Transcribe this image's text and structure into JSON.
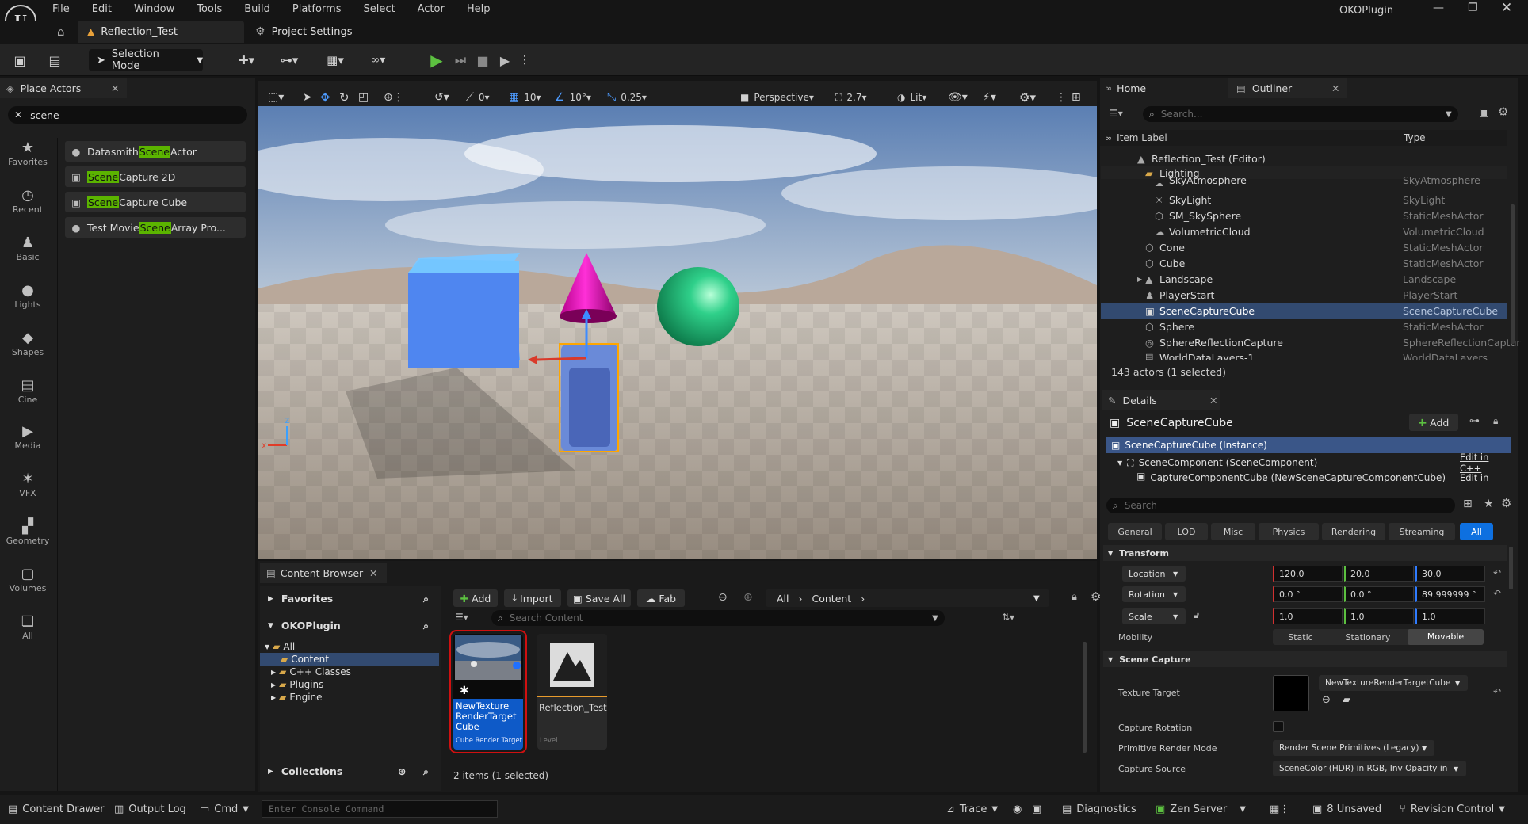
{
  "menu": [
    "File",
    "Edit",
    "Window",
    "Tools",
    "Build",
    "Platforms",
    "Select",
    "Actor",
    "Help"
  ],
  "project_name": "OKOPlugin",
  "tabs": {
    "level": "Reflection_Test",
    "project_settings": "Project Settings"
  },
  "toolbar": {
    "selection_mode": "Selection Mode"
  },
  "place_actors": {
    "tab_label": "Place Actors",
    "search_value": "scene",
    "categories": [
      "Favorites",
      "Recent",
      "Basic",
      "Lights",
      "Shapes",
      "Cine",
      "Media",
      "VFX",
      "Geometry",
      "Volumes",
      "All"
    ],
    "items": [
      {
        "pre": "Datasmith ",
        "match": "Scene",
        "post": " Actor"
      },
      {
        "pre": "",
        "match": "Scene",
        "post": " Capture 2D"
      },
      {
        "pre": "",
        "match": "Scene",
        "post": " Capture Cube"
      },
      {
        "pre": "Test Movie ",
        "match": "Scene",
        "post": " Array Pro..."
      }
    ]
  },
  "viewport": {
    "translate_snap": "0",
    "grid": "10",
    "rotate_snap": "10°",
    "scale_snap": "0.25",
    "perspective": "Perspective",
    "camera_speed": "2.7",
    "view_mode": "Lit",
    "axis_z": "Z",
    "axis_x": "X"
  },
  "outliner": {
    "home_tab": "Home",
    "tab_label": "Outliner",
    "search_placeholder": "Search...",
    "col_label": "Item Label",
    "col_type": "Type",
    "rows": [
      {
        "label": "Reflection_Test (Editor)",
        "type": ""
      },
      {
        "label": "Lighting",
        "type": ""
      },
      {
        "label": "SkyAtmosphere",
        "type": "SkyAtmosphere"
      },
      {
        "label": "SkyLight",
        "type": "SkyLight"
      },
      {
        "label": "SM_SkySphere",
        "type": "StaticMeshActor"
      },
      {
        "label": "VolumetricCloud",
        "type": "VolumetricCloud"
      },
      {
        "label": "Cone",
        "type": "StaticMeshActor"
      },
      {
        "label": "Cube",
        "type": "StaticMeshActor"
      },
      {
        "label": "Landscape",
        "type": "Landscape"
      },
      {
        "label": "PlayerStart",
        "type": "PlayerStart"
      },
      {
        "label": "SceneCaptureCube",
        "type": "SceneCaptureCube"
      },
      {
        "label": "Sphere",
        "type": "StaticMeshActor"
      },
      {
        "label": "SphereReflectionCapture",
        "type": "SphereReflectionCaptur"
      },
      {
        "label": "WorldDataLayers-1",
        "type": "WorldDataLayers"
      }
    ],
    "count": "143 actors (1 selected)"
  },
  "details": {
    "tab_label": "Details",
    "actor_name": "SceneCaptureCube",
    "add_label": "Add",
    "instance": "SceneCaptureCube (Instance)",
    "comp1": "SceneComponent (SceneComponent)",
    "comp2": "CaptureComponentCube (NewSceneCaptureComponentCube)",
    "edit_cpp": "Edit in C++",
    "search_placeholder": "Search",
    "filter_tabs": [
      "General",
      "LOD",
      "Misc",
      "Physics",
      "Rendering",
      "Streaming",
      "All"
    ],
    "transform_header": "Transform",
    "location_label": "Location",
    "location": [
      "120.0",
      "20.0",
      "30.0"
    ],
    "rotation_label": "Rotation",
    "rotation": [
      "0.0 °",
      "0.0 °",
      "89.999999 °"
    ],
    "scale_label": "Scale",
    "scale": [
      "1.0",
      "1.0",
      "1.0"
    ],
    "mobility_label": "Mobility",
    "mobility_options": [
      "Static",
      "Stationary",
      "Movable"
    ],
    "scene_capture_header": "Scene Capture",
    "texture_target_label": "Texture Target",
    "texture_target_value": "NewTextureRenderTargetCube",
    "capture_rotation_label": "Capture Rotation",
    "primitive_mode_label": "Primitive Render Mode",
    "primitive_mode_value": "Render Scene Primitives (Legacy)",
    "capture_source_label": "Capture Source",
    "capture_source_value": "SceneColor (HDR) in RGB, Inv Opacity in A"
  },
  "content_browser": {
    "tab_label": "Content Browser",
    "favorites": "Favorites",
    "project": "OKOPlugin",
    "tree": [
      "All",
      "Content",
      "C++ Classes",
      "Plugins",
      "Engine"
    ],
    "collections": "Collections",
    "add": "Add",
    "import": "Import",
    "save_all": "Save All",
    "fab": "Fab",
    "path": [
      "All",
      "Content"
    ],
    "search_placeholder": "Search Content",
    "asset1_name": "NewTexture RenderTarget Cube",
    "asset1_type": "Cube Render Target",
    "asset2_name": "Reflection_Test",
    "asset2_type": "Level",
    "count": "2 items (1 selected)"
  },
  "statusbar": {
    "content_drawer": "Content Drawer",
    "output_log": "Output Log",
    "cmd": "Cmd",
    "console_placeholder": "Enter Console Command",
    "trace": "Trace",
    "diagnostics": "Diagnostics",
    "zen": "Zen Server",
    "unsaved": "8 Unsaved",
    "revision": "Revision Control"
  },
  "colors": {
    "accent": "#2f5ea8",
    "selection": "#324a70",
    "highlight": "#5bb400",
    "play": "#5cc040"
  }
}
